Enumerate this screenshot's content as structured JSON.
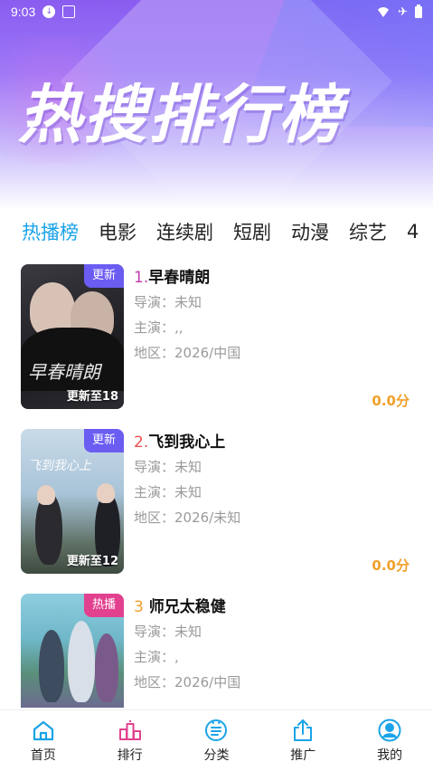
{
  "status_bar": {
    "time": "9:03"
  },
  "header": {
    "title": "热搜排行榜"
  },
  "tabs": [
    {
      "label": "热播榜",
      "active": true
    },
    {
      "label": "电影",
      "active": false
    },
    {
      "label": "连续剧",
      "active": false
    },
    {
      "label": "短剧",
      "active": false
    },
    {
      "label": "动漫",
      "active": false
    },
    {
      "label": "综艺",
      "active": false
    },
    {
      "label": "4",
      "active": false
    }
  ],
  "items": [
    {
      "rank": "1.",
      "rank_color": "#c43bb0",
      "title": "早春晴朗",
      "badge": "更新",
      "badge_color": "#6b5cf2",
      "episodes": "更新至18",
      "poster_text": "早春晴朗",
      "director": "导演：未知",
      "cast": "主演：,,",
      "region": "地区：2026/中国",
      "score": "0.0分"
    },
    {
      "rank": "2.",
      "rank_color": "#f05050",
      "title": "飞到我心上",
      "badge": "更新",
      "badge_color": "#6b5cf2",
      "episodes": "更新至12",
      "poster_text": "飞到我心上",
      "director": "导演：未知",
      "cast": "主演：未知",
      "region": "地区：2026/未知",
      "score": "0.0分"
    },
    {
      "rank": "3",
      "rank_color": "#f0a02a",
      "title": "师兄太稳健",
      "badge": "热播",
      "badge_color": "#e2418f",
      "episodes": "",
      "poster_text": "",
      "director": "导演：未知",
      "cast": "主演：,",
      "region": "地区：2026/中国",
      "score": ""
    }
  ],
  "bottom_nav": [
    {
      "label": "首页",
      "icon": "home-icon"
    },
    {
      "label": "排行",
      "icon": "ranking-icon"
    },
    {
      "label": "分类",
      "icon": "category-icon"
    },
    {
      "label": "推广",
      "icon": "share-icon"
    },
    {
      "label": "我的",
      "icon": "profile-icon"
    }
  ],
  "colors": {
    "accent": "#1aa3e8",
    "score": "#f0a02a"
  }
}
